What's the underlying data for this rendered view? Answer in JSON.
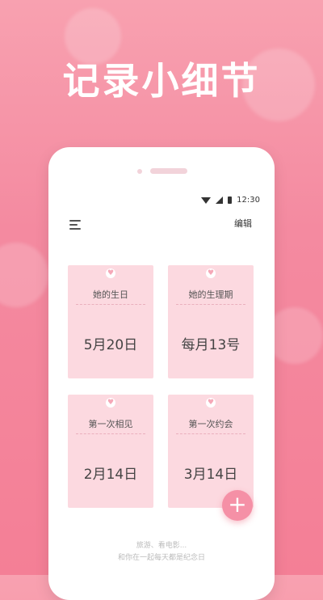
{
  "headline": "记录小细节",
  "status_bar": {
    "time": "12:30"
  },
  "toolbar": {
    "edit_label": "编辑"
  },
  "cards": [
    {
      "label": "她的生日",
      "date": "5月20日"
    },
    {
      "label": "她的生理期",
      "date": "每月13号"
    },
    {
      "label": "第一次相见",
      "date": "2月14日"
    },
    {
      "label": "第一次约会",
      "date": "3月14日"
    }
  ],
  "fab": {
    "symbol": "+"
  },
  "footer": {
    "line1": "旅游、看电影...",
    "line2": "和你在一起每天都是纪念日"
  },
  "colors": {
    "background": "#f48aa0",
    "card": "#fcd9e0",
    "accent": "#f590a6"
  }
}
